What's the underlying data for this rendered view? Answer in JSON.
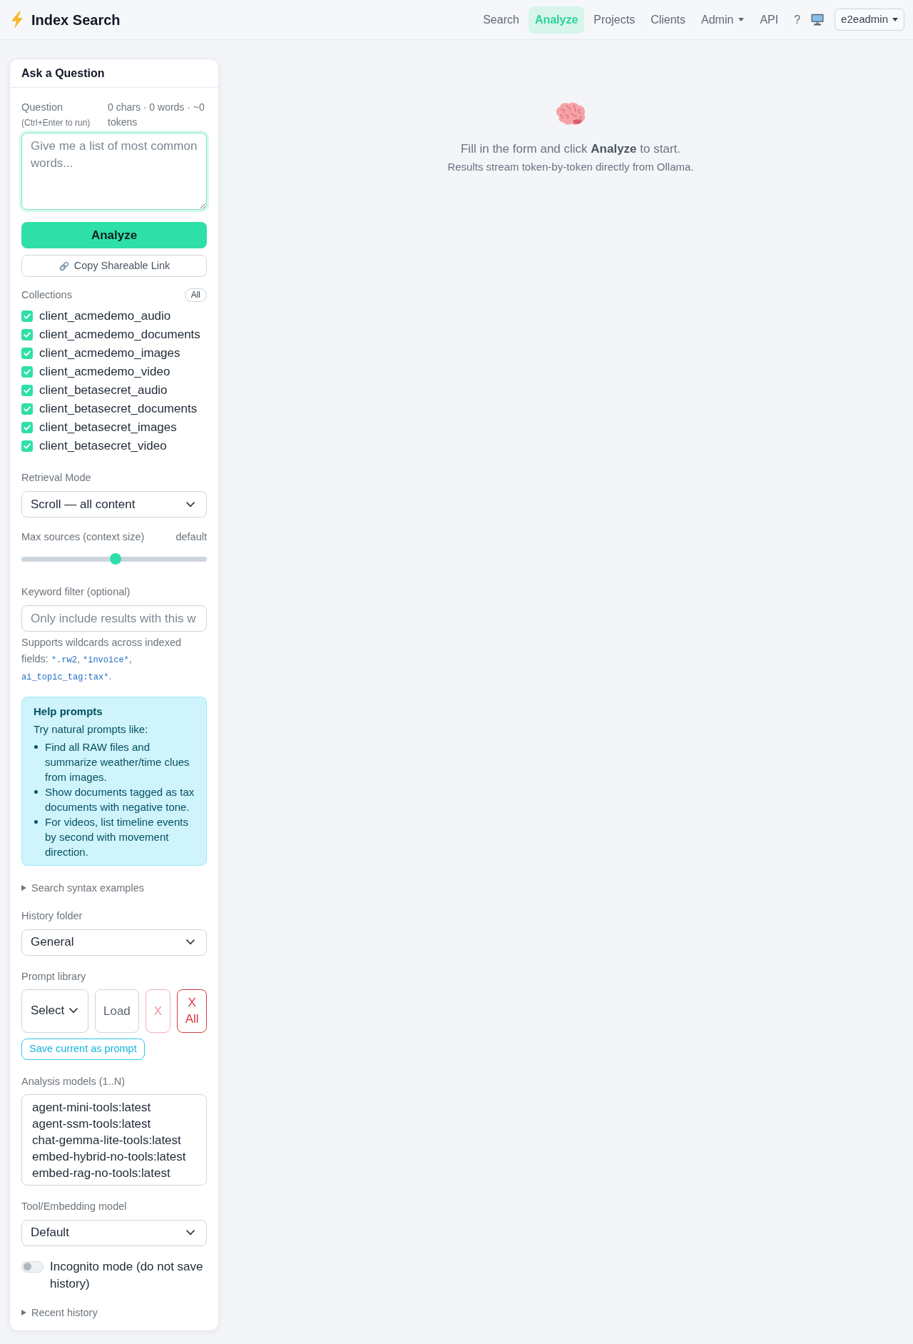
{
  "navbar": {
    "brand": "Index Search",
    "links": [
      {
        "label": "Search",
        "kind": "link",
        "selected": false
      },
      {
        "label": "Analyze",
        "kind": "link",
        "selected": true
      },
      {
        "label": "Projects",
        "kind": "link",
        "selected": false
      },
      {
        "label": "Clients",
        "kind": "link",
        "selected": false
      },
      {
        "label": "Admin",
        "kind": "dropdown",
        "selected": false
      },
      {
        "label": "API",
        "kind": "link",
        "selected": false
      },
      {
        "label": "?",
        "kind": "link",
        "selected": false
      }
    ],
    "user_menu": "e2eadmin"
  },
  "ask_panel": {
    "title": "Ask a Question",
    "question": {
      "label": "Question",
      "hint": "(Ctrl+Enter to run)",
      "counter": "0 chars · 0 words · ~0 tokens",
      "placeholder": "Give me a list of most common words...",
      "focused": true
    },
    "analyze_button": "Analyze",
    "share_button": "Copy Shareable Link",
    "collections": {
      "label": "Collections",
      "all_button": "All",
      "items": [
        {
          "name": "client_acmedemo_audio",
          "checked": true
        },
        {
          "name": "client_acmedemo_documents",
          "checked": true
        },
        {
          "name": "client_acmedemo_images",
          "checked": true
        },
        {
          "name": "client_acmedemo_video",
          "checked": true
        },
        {
          "name": "client_betasecret_audio",
          "checked": true
        },
        {
          "name": "client_betasecret_documents",
          "checked": true
        },
        {
          "name": "client_betasecret_images",
          "checked": true
        },
        {
          "name": "client_betasecret_video",
          "checked": true
        }
      ]
    },
    "retrieval_mode": {
      "label": "Retrieval Mode",
      "value": "Scroll — all content"
    },
    "max_sources": {
      "label": "Max sources (context size)",
      "reading": "default",
      "level": 0.51
    },
    "keyword_filter": {
      "label": "Keyword filter (optional)",
      "placeholder": "Only include results with this w",
      "help": [
        {
          "kind": "text",
          "text": "Supports wildcards across indexed fields: "
        },
        {
          "kind": "code",
          "text": "*.rw2"
        },
        {
          "kind": "text",
          "text": ", "
        },
        {
          "kind": "code",
          "text": "*invoice*"
        },
        {
          "kind": "text",
          "text": ", "
        },
        {
          "kind": "code",
          "text": "ai_topic_tag:tax*"
        },
        {
          "kind": "text",
          "text": "."
        }
      ]
    },
    "help_prompts": {
      "title": "Help prompts",
      "intro": "Try natural prompts like:",
      "items": [
        "Find all RAW files and summarize weather/time clues from images.",
        "Show documents tagged as tax documents with negative tone.",
        "For videos, list timeline events by second with movement direction."
      ]
    },
    "syntax_examples": {
      "label": "Search syntax examples",
      "expanded": false
    },
    "history_folder": {
      "label": "History folder",
      "value": "General"
    },
    "prompt_library": {
      "label": "Prompt library",
      "select": "Select",
      "buttons": [
        {
          "label": "Load",
          "kind": "outline",
          "disabled": false
        },
        {
          "label": "X",
          "kind": "danger",
          "disabled": true
        },
        {
          "label": "X All",
          "kind": "danger",
          "disabled": false
        }
      ],
      "save_button": "Save current as prompt"
    },
    "analysis_models": {
      "label": "Analysis models (1..N)",
      "options": [
        {
          "name": "agent-mini-tools:latest",
          "selected": false
        },
        {
          "name": "agent-ssm-tools:latest",
          "selected": false
        },
        {
          "name": "chat-gemma-lite-tools:latest",
          "selected": false
        },
        {
          "name": "embed-hybrid-no-tools:latest",
          "selected": false
        },
        {
          "name": "embed-rag-no-tools:latest",
          "selected": false
        }
      ]
    },
    "tool_model": {
      "label": "Tool/Embedding model",
      "value": "Default"
    },
    "incognito": {
      "label": "Incognito mode (do not save history)",
      "on": false
    },
    "recent_history": {
      "label": "Recent history",
      "expanded": false
    }
  },
  "empty_state": {
    "message": "Fill in the form and click **Analyze** to start.",
    "note": "Results stream token-by-token directly from Ollama."
  }
}
